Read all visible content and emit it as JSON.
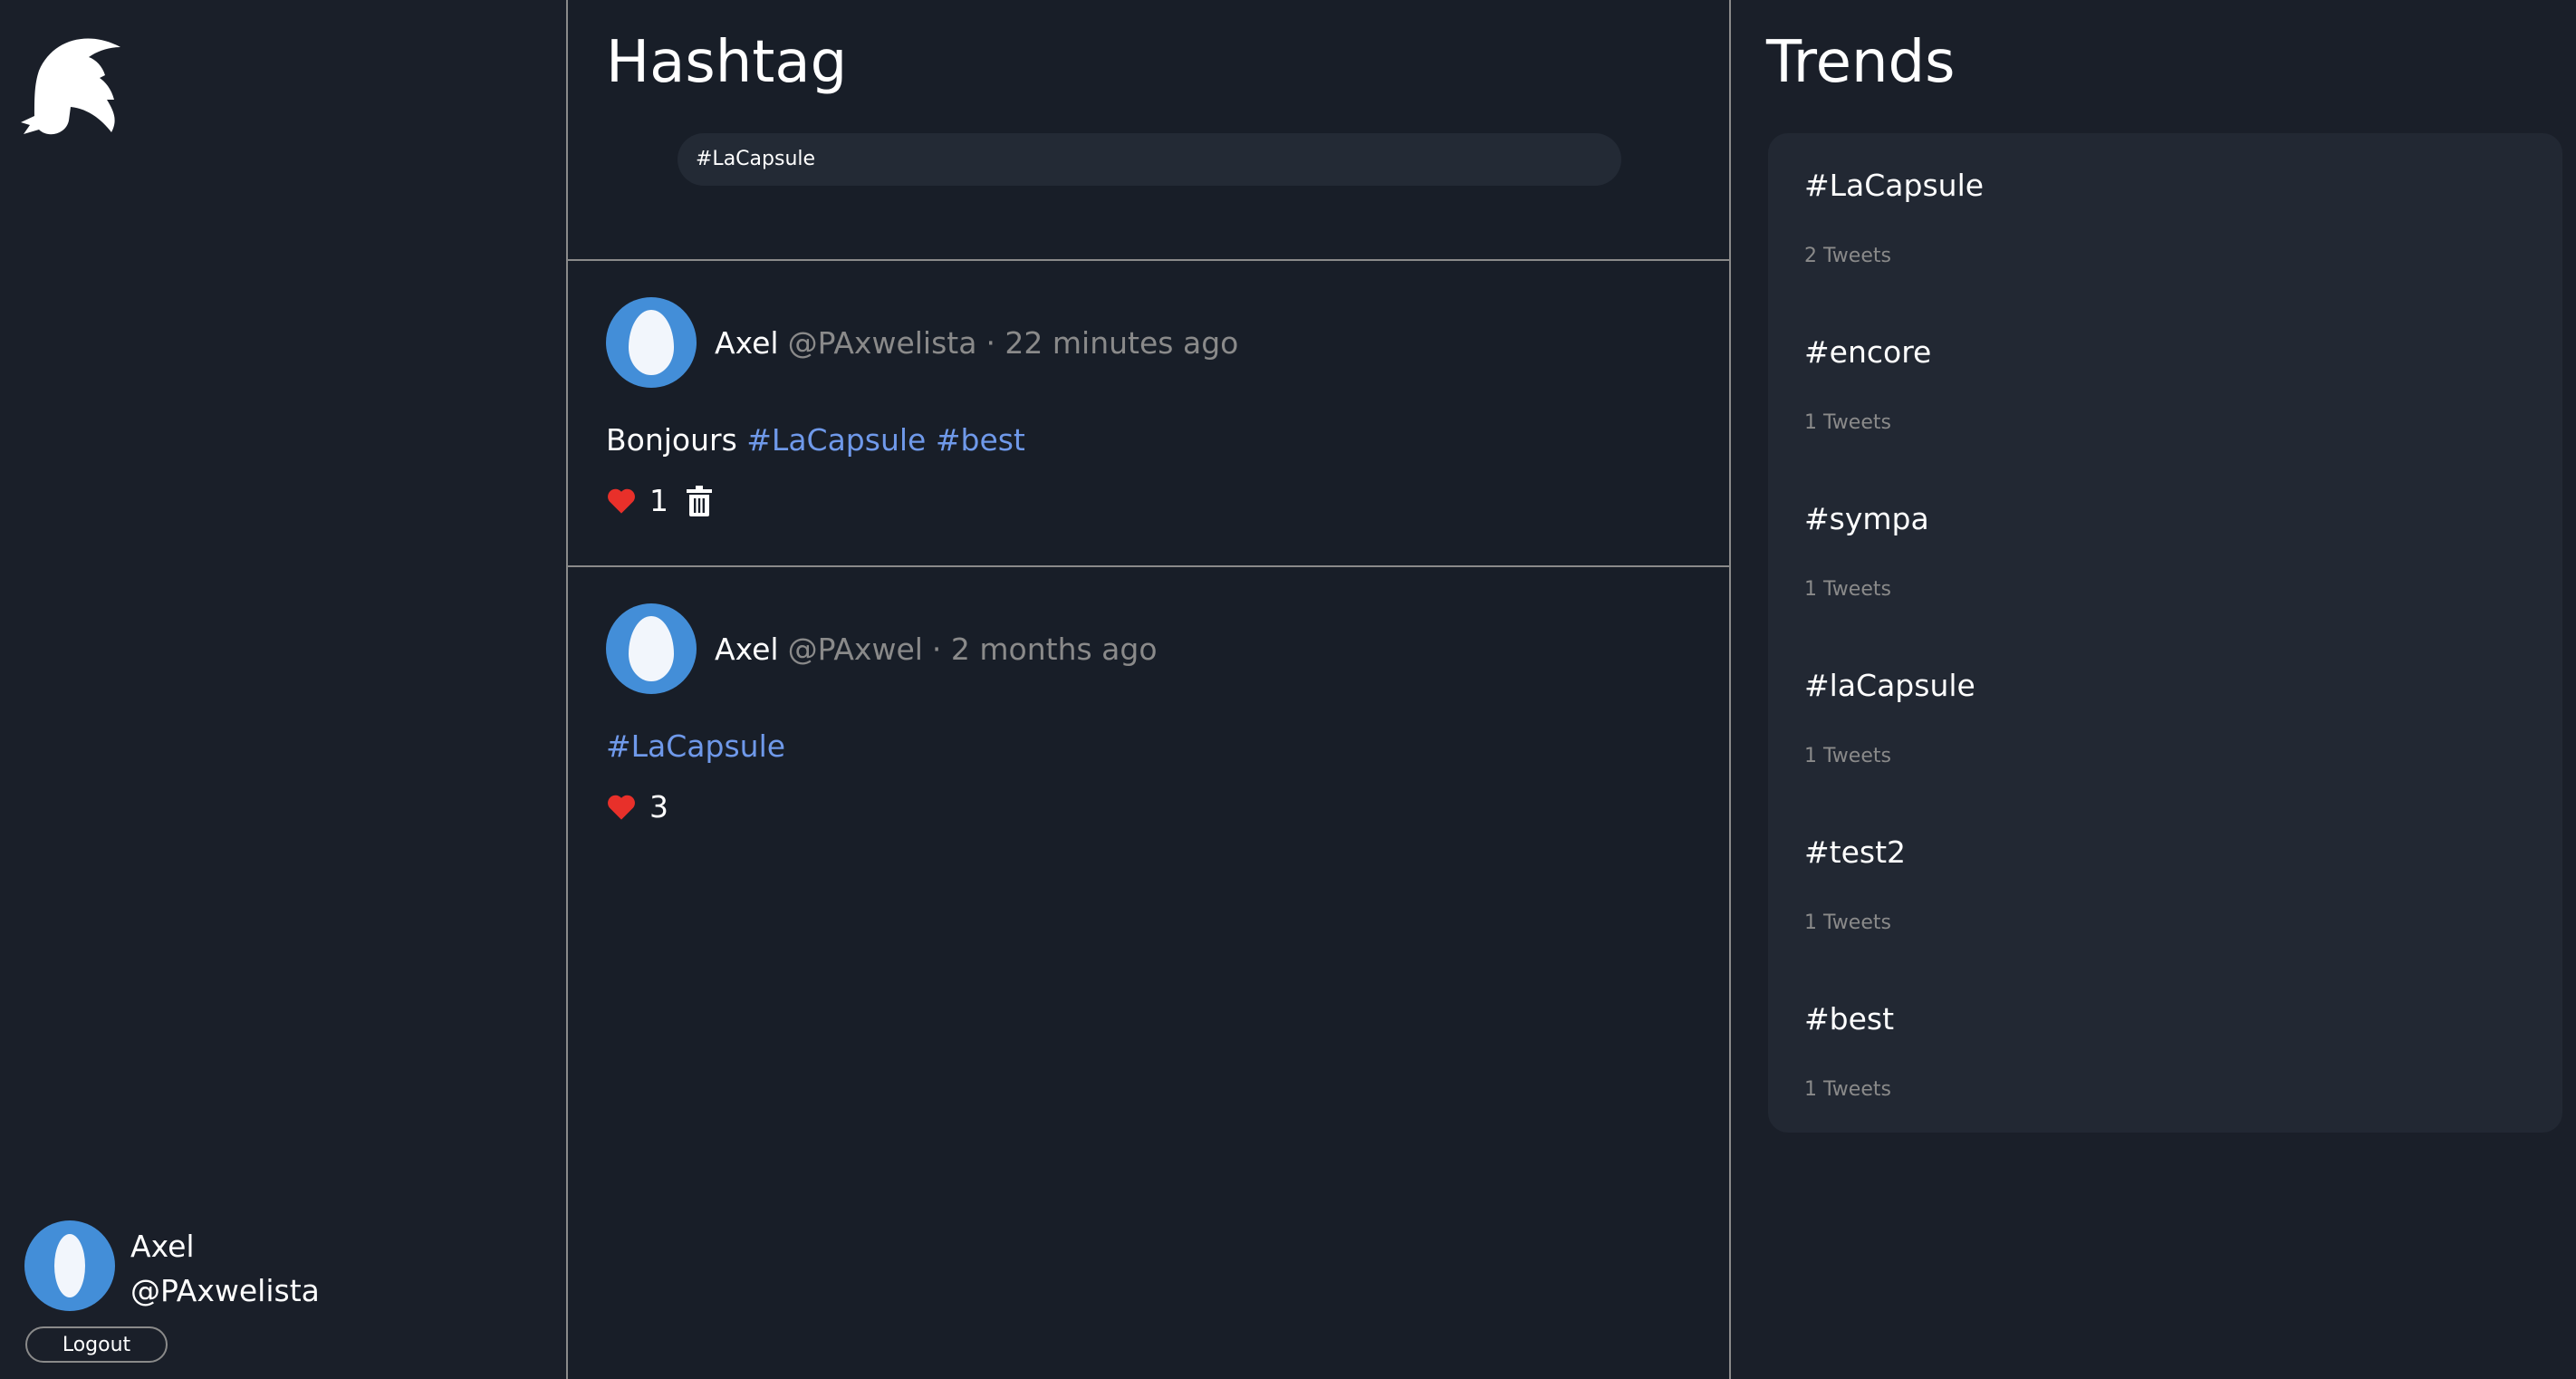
{
  "sidebar": {
    "user": {
      "name": "Axel",
      "handle": "@PAxwelista"
    },
    "logout_label": "Logout"
  },
  "main": {
    "title": "Hashtag",
    "search_value": "#LaCapsule",
    "tweets": [
      {
        "name": "Axel",
        "handle": "@PAxwelista",
        "time": "· 22 minutes ago",
        "text": "Bonjours",
        "tags": [
          "#LaCapsule",
          "#best"
        ],
        "likes": "1",
        "deletable": true
      },
      {
        "name": "Axel",
        "handle": "@PAxwel",
        "time": "· 2 months ago",
        "text": "",
        "tags": [
          "#LaCapsule"
        ],
        "likes": "3",
        "deletable": false
      }
    ]
  },
  "trends": {
    "title": "Trends",
    "items": [
      {
        "tag": "#LaCapsule",
        "count": "2 Tweets"
      },
      {
        "tag": "#encore",
        "count": "1 Tweets"
      },
      {
        "tag": "#sympa",
        "count": "1 Tweets"
      },
      {
        "tag": "#laCapsule",
        "count": "1 Tweets"
      },
      {
        "tag": "#test2",
        "count": "1 Tweets"
      },
      {
        "tag": "#best",
        "count": "1 Tweets"
      }
    ]
  },
  "colors": {
    "accent": "#438ed8",
    "hashtag": "#6f99ea",
    "like": "#e8302a",
    "bg": "#181e28"
  }
}
